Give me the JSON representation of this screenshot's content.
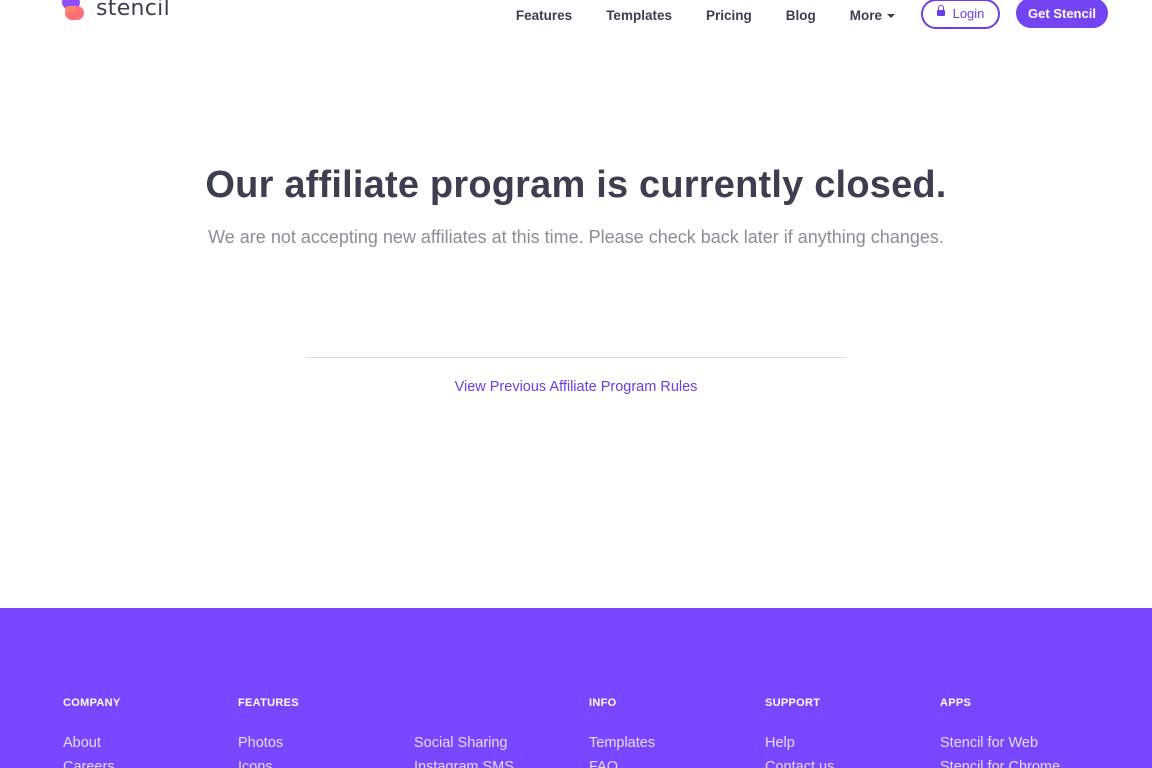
{
  "header": {
    "logo_text": "stencil",
    "nav": [
      "Features",
      "Templates",
      "Pricing",
      "Blog",
      "More"
    ],
    "login_label": "Login",
    "cta_label": "Get Stencil"
  },
  "hero": {
    "title": "Our affiliate program is currently closed.",
    "subtitle": "We are not accepting new affiliates at this time. Please check back later if anything changes."
  },
  "prev_rules_link": "View Previous Affiliate Program Rules",
  "footer": {
    "columns": [
      {
        "heading": "COMPANY",
        "links": [
          "About",
          "Careers"
        ]
      },
      {
        "heading": "FEATURES",
        "links": [
          "Photos",
          "Icons"
        ]
      },
      {
        "heading": "",
        "links": [
          "Social Sharing",
          "Instagram SMS"
        ]
      },
      {
        "heading": "INFO",
        "links": [
          "Templates",
          "FAQ"
        ]
      },
      {
        "heading": "SUPPORT",
        "links": [
          "Help",
          "Contact us"
        ]
      },
      {
        "heading": "APPS",
        "links": [
          "Stencil for Web",
          "Stencil for Chrome"
        ]
      }
    ]
  },
  "colors": {
    "brand_purple": "#7444f2",
    "footer_bg": "#7847ff",
    "text_dark": "#3d3f51",
    "text_muted": "#8b8e97"
  },
  "icons": {
    "logo": "stencil-logo-icon",
    "login": "lock-icon",
    "more": "caret-down-icon"
  }
}
